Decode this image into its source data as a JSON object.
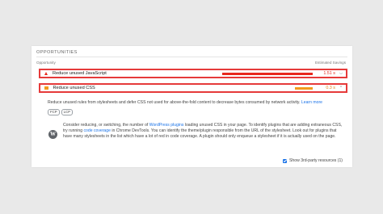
{
  "section": {
    "title": "OPPORTUNITIES"
  },
  "columns": {
    "left": "Opportunity",
    "right": "Estimated Savings"
  },
  "rows": [
    {
      "label": "Reduce unused JavaScript",
      "value": "1.51 s",
      "fraction": 1.0,
      "color": "#e8281e"
    },
    {
      "label": "Reduce unused CSS",
      "value": "0.3 s",
      "fraction": 0.2,
      "color": "#f39a1e"
    }
  ],
  "description": {
    "text": "Reduce unused rules from stylesheets and defer CSS not used for above-the-fold content to decrease bytes consumed by network activity.",
    "link": "Learn more"
  },
  "chips": [
    "FCP",
    "LCP"
  ],
  "wordpress": {
    "p1": "Consider reducing, or switching, the number of ",
    "link1": "WordPress plugins",
    "p2": " loading unused CSS in your page. To identify plugins that are adding extraneous CSS, try running ",
    "link2": "code coverage",
    "p3": " in Chrome DevTools. You can identify the theme/plugin responsible from the URL of the stylesheet. Look out for plugins that have many stylesheets in the list which have a lot of red in code coverage. A plugin should only enqueue a stylesheet if it is actually used on the page."
  },
  "footer": {
    "checkbox_label": "Show 3rd-party resources (1)",
    "checked": true
  }
}
